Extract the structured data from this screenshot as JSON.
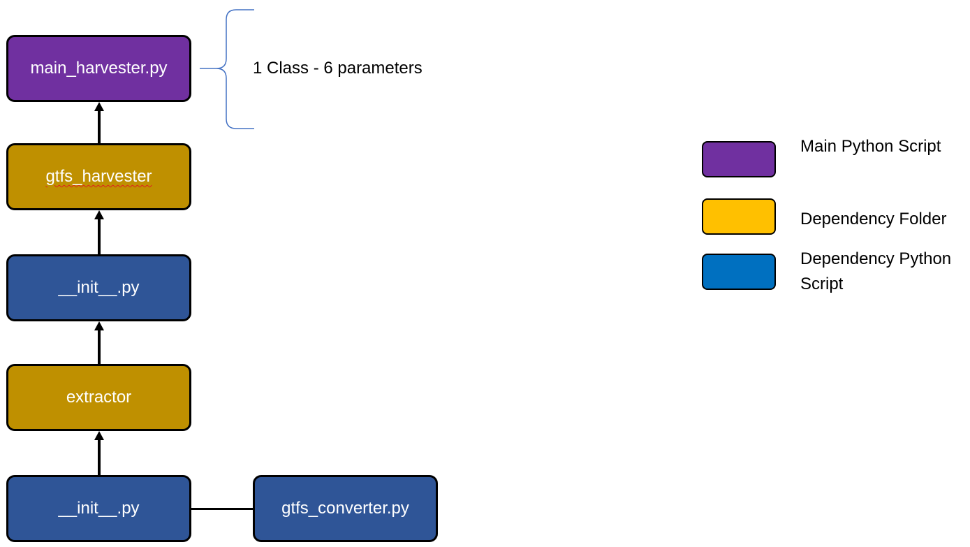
{
  "colors": {
    "main_script": "#7030A0",
    "folder_node": "#BF9000",
    "dependency_script": "#2F5597",
    "legend_folder": "#FFC000",
    "legend_dependency_script": "#0070C0",
    "brace": "#4472C4"
  },
  "nodes": {
    "main_harvester": "main_harvester.py",
    "gtfs_harvester": "gtfs_harvester",
    "init_top": "__init__.py",
    "extractor": "extractor",
    "init_bottom": "__init__.py",
    "gtfs_converter": "gtfs_converter.py"
  },
  "annotation": {
    "brace_label": "1 Class - 6 parameters"
  },
  "legend": {
    "items": [
      {
        "label": "Main Python Script",
        "color": "#7030A0"
      },
      {
        "label": "Dependency Folder",
        "color": "#FFC000"
      },
      {
        "label": "Dependency Python Script",
        "color": "#0070C0"
      }
    ]
  }
}
